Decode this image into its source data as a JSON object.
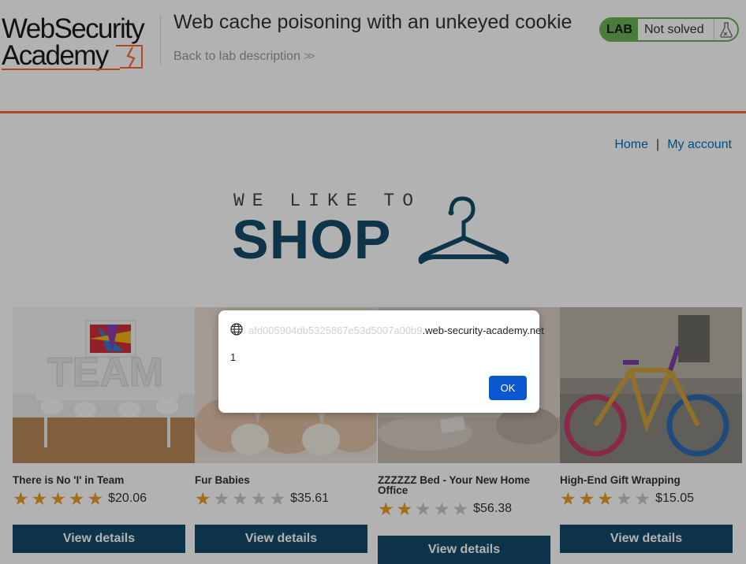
{
  "header": {
    "logo_line1": "WebSecurity",
    "logo_line2": "Academy",
    "lab_title": "Web cache poisoning with an unkeyed cookie",
    "back_link": "Back to lab description",
    "status_badge": "LAB",
    "status_text": "Not solved",
    "flask_icon": "flask-icon"
  },
  "nav": {
    "home": "Home",
    "separator": "|",
    "account": "My account"
  },
  "shop_logo": {
    "tagline": "WE LIKE TO",
    "word": "SHOP",
    "icon": "hanger-icon"
  },
  "products": [
    {
      "name": "There is No 'I' in Team",
      "rating": 5,
      "price": "$20.06",
      "button": "View details"
    },
    {
      "name": "Fur Babies",
      "rating": 1,
      "price": "$35.61",
      "button": "View details"
    },
    {
      "name": "ZZZZZZ Bed - Your New Home Office",
      "rating": 2,
      "price": "$56.38",
      "button": "View details"
    },
    {
      "name": "High-End Gift Wrapping",
      "rating": 3,
      "price": "$15.05",
      "button": "View details"
    }
  ],
  "alert": {
    "origin_prefix": "afd005904db5325867e53d5007a00b9",
    "origin_suffix": ".web-security-academy.net",
    "message": "1",
    "ok_label": "OK",
    "icon": "globe-icon"
  },
  "colors": {
    "accent_orange": "#ff6633",
    "brand_blue": "#154b6a",
    "link_blue": "#0071bc",
    "status_green": "#6bb154",
    "star_gold": "#e89e24",
    "dialog_button": "#0b57d0"
  }
}
